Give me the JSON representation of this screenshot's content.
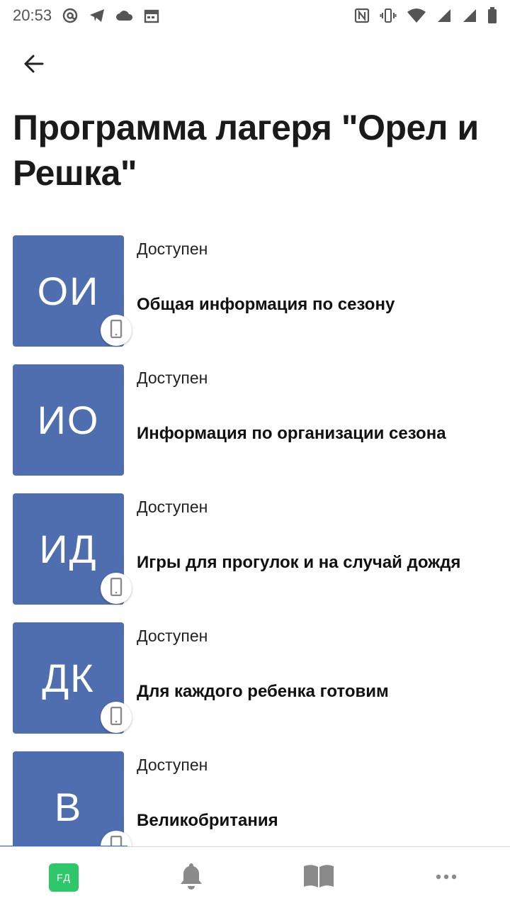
{
  "status_bar": {
    "time": "20:53",
    "left_icons": [
      "at-sign-icon",
      "telegram-icon",
      "cloud-icon",
      "calendar-icon"
    ],
    "right_icons": [
      "nfc-icon",
      "vibrate-icon",
      "wifi-icon",
      "signal-icon",
      "signal-icon",
      "battery-icon"
    ]
  },
  "header": {
    "back_icon": "arrow-left-icon",
    "title": "Программа лагеря \"Орел и Решка\""
  },
  "items": [
    {
      "initials": "ОИ",
      "status": "Доступен",
      "title": "Общая информация по сезону",
      "device_badge": true
    },
    {
      "initials": "ИО",
      "status": "Доступен",
      "title": "Информация по организации сезона",
      "device_badge": false
    },
    {
      "initials": "ИД",
      "status": "Доступен",
      "title": "Игры для прогулок и на случай дождя",
      "device_badge": true
    },
    {
      "initials": "ДК",
      "status": "Доступен",
      "title": "Для каждого ребенка готовим",
      "device_badge": true
    },
    {
      "initials": "В",
      "status": "Доступен",
      "title": "Великобритания",
      "device_badge": true
    }
  ],
  "bottom_nav": {
    "avatar_initials": "FД",
    "items": [
      "profile-avatar",
      "bell-icon",
      "book-icon",
      "more-icon"
    ]
  },
  "colors": {
    "tile": "#4f6eb0",
    "avatar": "#2ec76a",
    "progress": "#2f6fe0",
    "nav_icon": "#8a8a8a"
  }
}
